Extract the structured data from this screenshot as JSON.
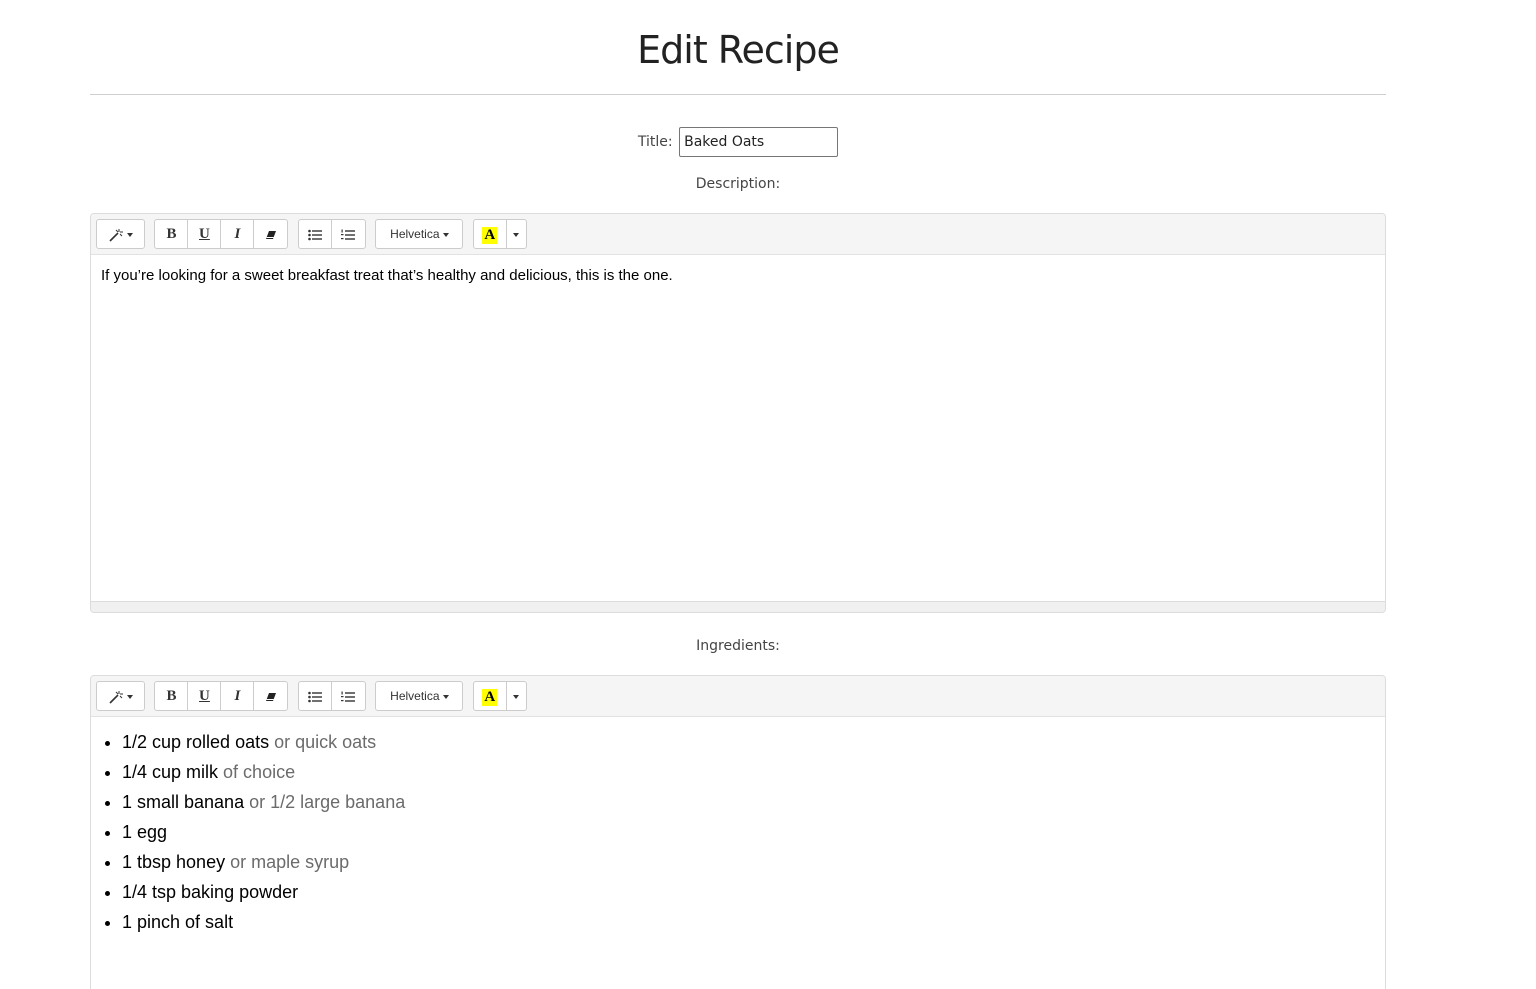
{
  "page": {
    "heading": "Edit Recipe"
  },
  "title_field": {
    "label": "Title:",
    "value": "Baked Oats"
  },
  "description": {
    "label": "Description:",
    "text": "If you’re looking for a sweet breakfast treat that’s healthy and delicious, this is the one."
  },
  "ingredients": {
    "label": "Ingredients:",
    "items": [
      {
        "main": "1/2 cup rolled oats",
        "note": " or quick oats"
      },
      {
        "main": "1/4 cup milk",
        "note": " of choice"
      },
      {
        "main": "1 small banana",
        "note": " or 1/2 large banana"
      },
      {
        "main": "1 egg",
        "note": ""
      },
      {
        "main": "1 tbsp honey",
        "note": " or maple syrup"
      },
      {
        "main": "1/4 tsp baking powder",
        "note": ""
      },
      {
        "main": "1 pinch of salt",
        "note": ""
      }
    ]
  },
  "toolbar": {
    "style_icon": "magic-wand-icon",
    "bold_label": "B",
    "underline_label": "U",
    "italic_label": "I",
    "eraser_icon": "eraser-icon",
    "unordered_list_icon": "unordered-list-icon",
    "ordered_list_icon": "ordered-list-icon",
    "font_name": "Helvetica",
    "color_label": "A",
    "highlight_color": "#ffff00"
  }
}
